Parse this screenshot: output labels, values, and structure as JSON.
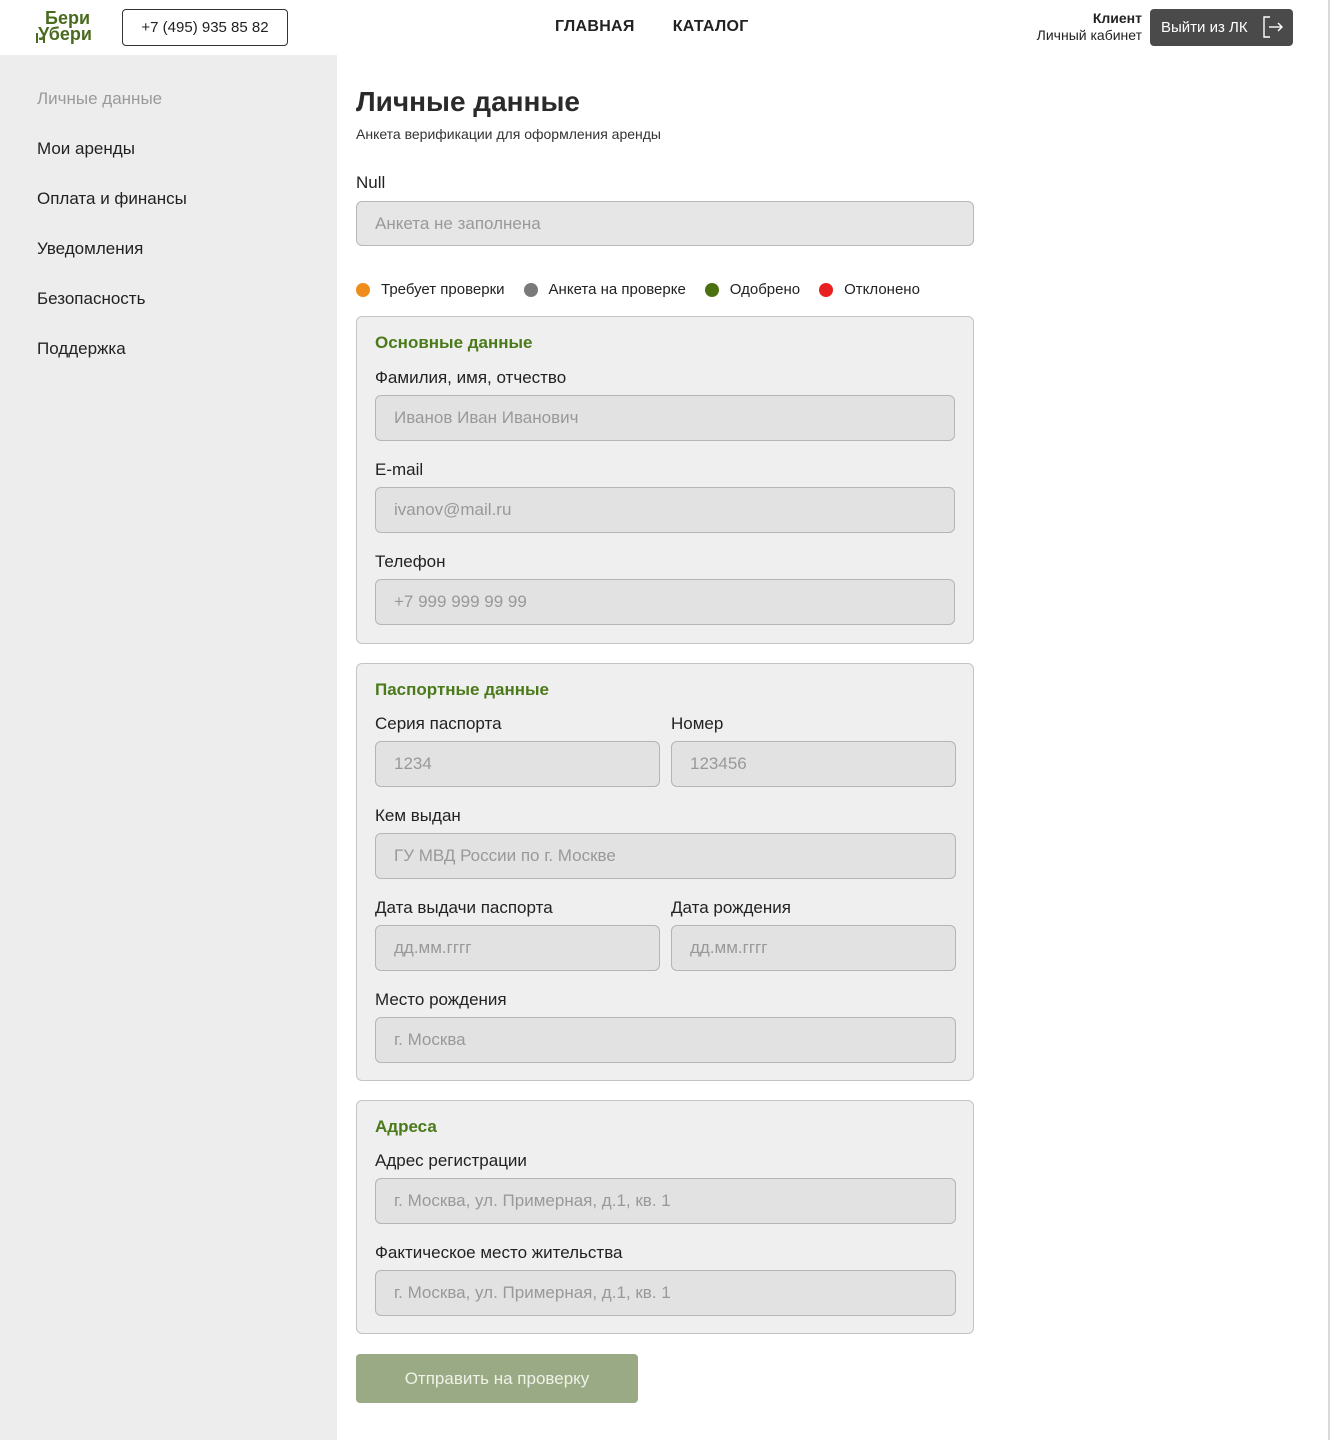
{
  "header": {
    "logo_top": "Бери",
    "logo_bottom": "Убери",
    "phone": "+7 (495) 935 85 82",
    "nav": [
      "ГЛАВНАЯ",
      "КАТАЛОГ"
    ],
    "user_role": "Клиент",
    "user_sub": "Личный кабинет",
    "logout_label": "Выйти из ЛК"
  },
  "sidebar": {
    "items": [
      {
        "label": "Личные данные",
        "active": true
      },
      {
        "label": "Мои аренды"
      },
      {
        "label": "Оплата и финансы"
      },
      {
        "label": "Уведомления"
      },
      {
        "label": "Безопасность"
      },
      {
        "label": "Поддержка"
      }
    ]
  },
  "main": {
    "title": "Личные данные",
    "subtitle": "Анкета верификации для оформления аренды",
    "status_label": "Null",
    "status_placeholder": "Анкета не заполнена",
    "legend": [
      {
        "label": "Требует проверки",
        "color": "#f08c1a"
      },
      {
        "label": "Анкета на проверке",
        "color": "#7a7a7a"
      },
      {
        "label": "Одобрено",
        "color": "#4a7010"
      },
      {
        "label": "Отклонено",
        "color": "#e82020"
      }
    ],
    "basic": {
      "title": "Основные данные",
      "fio_label": "Фамилия, имя, отчество",
      "fio_placeholder": "Иванов Иван Иванович",
      "email_label": "E-mail",
      "email_placeholder": "ivanov@mail.ru",
      "phone_label": "Телефон",
      "phone_placeholder": "+7 999 999 99 99"
    },
    "passport": {
      "title": "Паспортные данные",
      "series_label": "Серия паспорта",
      "series_placeholder": "1234",
      "number_label": "Номер",
      "number_placeholder": "123456",
      "issued_label": "Кем выдан",
      "issued_placeholder": "ГУ МВД России по г. Москве",
      "issue_date_label": "Дата выдачи паспорта",
      "issue_date_placeholder": "дд.мм.гггг",
      "birth_date_label": "Дата рождения",
      "birth_date_placeholder": "дд.мм.гггг",
      "birth_place_label": "Место рождения",
      "birth_place_placeholder": "г. Москва"
    },
    "address": {
      "title": "Адреса",
      "reg_label": "Адрес регистрации",
      "reg_placeholder": "г. Москва, ул. Примерная, д.1, кв. 1",
      "actual_label": "Фактическое место жительства",
      "actual_placeholder": "г. Москва, ул. Примерная, д.1, кв. 1"
    },
    "submit_label": "Отправить на проверку"
  }
}
